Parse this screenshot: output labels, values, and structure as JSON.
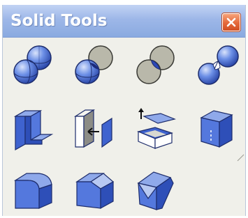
{
  "window": {
    "title": "Solid Tools",
    "close_label": "close"
  },
  "tools": [
    {
      "name": "union-tool",
      "icon": "union-icon"
    },
    {
      "name": "subtract-tool",
      "icon": "subtract-icon"
    },
    {
      "name": "intersect-tool",
      "icon": "intersect-icon"
    },
    {
      "name": "split-tool",
      "icon": "split-icon"
    },
    {
      "name": "push-pull-tool",
      "icon": "push-pull-icon"
    },
    {
      "name": "extrude-tool",
      "icon": "extrude-icon"
    },
    {
      "name": "shell-tool",
      "icon": "shell-icon"
    },
    {
      "name": "solid-box-tool",
      "icon": "solid-box-icon"
    },
    {
      "name": "fillet-tool",
      "icon": "fillet-icon"
    },
    {
      "name": "chamfer-tool",
      "icon": "chamfer-icon"
    },
    {
      "name": "corner-cut-tool",
      "icon": "corner-cut-icon"
    }
  ],
  "colors": {
    "title_bar": "#9db7e8",
    "panel": "#f0f0ea",
    "close_button": "#e4683a",
    "icon_blue": "#3f63cf",
    "icon_blue_light": "#b7c8f2",
    "icon_grey": "#a9a99a"
  }
}
